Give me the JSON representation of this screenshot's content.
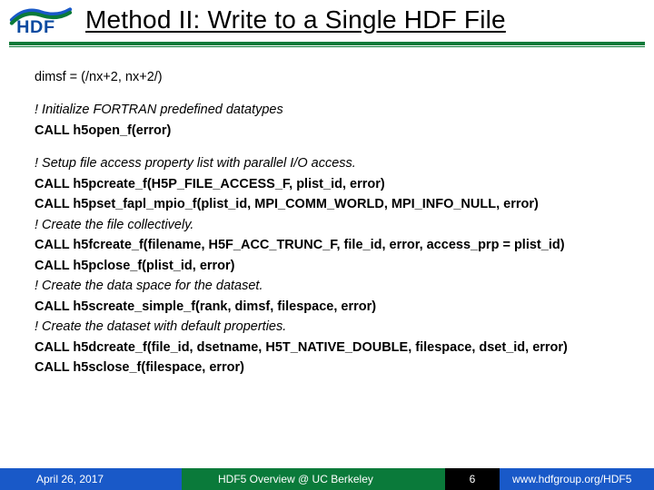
{
  "header": {
    "logo_text": "HDF",
    "title": "Method II: Write to a Single HDF File"
  },
  "code": {
    "line01": "dimsf = (/nx+2, nx+2/)",
    "line02": "! Initialize FORTRAN predefined datatypes",
    "line03": "CALL h5open_f(error)",
    "line04": "! Setup file access property list with parallel I/O access.",
    "line05": "CALL h5pcreate_f(H5P_FILE_ACCESS_F, plist_id, error)",
    "line06": "CALL h5pset_fapl_mpio_f(plist_id, MPI_COMM_WORLD, MPI_INFO_NULL, error)",
    "line07": "! Create the file collectively.",
    "line08": "CALL h5fcreate_f(filename, H5F_ACC_TRUNC_F, file_id, error, access_prp = plist_id)",
    "line09": "CALL h5pclose_f(plist_id, error)",
    "line10": "! Create the data space for the  dataset.",
    "line11": "CALL h5screate_simple_f(rank, dimsf, filespace, error)",
    "line12": "! Create the dataset with default properties.",
    "line13": "CALL h5dcreate_f(file_id, dsetname, H5T_NATIVE_DOUBLE, filespace, dset_id, error)",
    "line14": "CALL h5sclose_f(filespace, error)"
  },
  "footer": {
    "date": "April 26, 2017",
    "mid": "HDF5 Overview @ UC Berkeley",
    "num": "6",
    "url": "www.hdfgroup.org/HDF5"
  }
}
